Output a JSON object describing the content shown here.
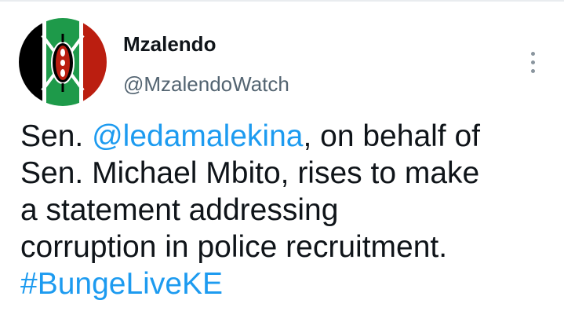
{
  "tweet": {
    "author": {
      "display_name": "Mzalendo",
      "handle": "@MzalendoWatch",
      "avatar_icon": "kenya-flag-shield-icon"
    },
    "more_icon": "more-vertical-icon",
    "text": {
      "line1_prefix": "Sen. ",
      "mention": "@ledamalekina",
      "line1_suffix": ", on behalf of",
      "line2": "Sen. Michael Mbito, rises to make",
      "line3": "a statement addressing",
      "line4": "corruption in police recruitment.",
      "hashtag": "#BungeLiveKE"
    }
  },
  "colors": {
    "text_primary": "#0f1419",
    "text_secondary": "#536471",
    "link": "#1d9bf0",
    "flag_black": "#000000",
    "flag_red": "#bb1e10",
    "flag_green": "#1e9a4a",
    "flag_white": "#ffffff"
  }
}
